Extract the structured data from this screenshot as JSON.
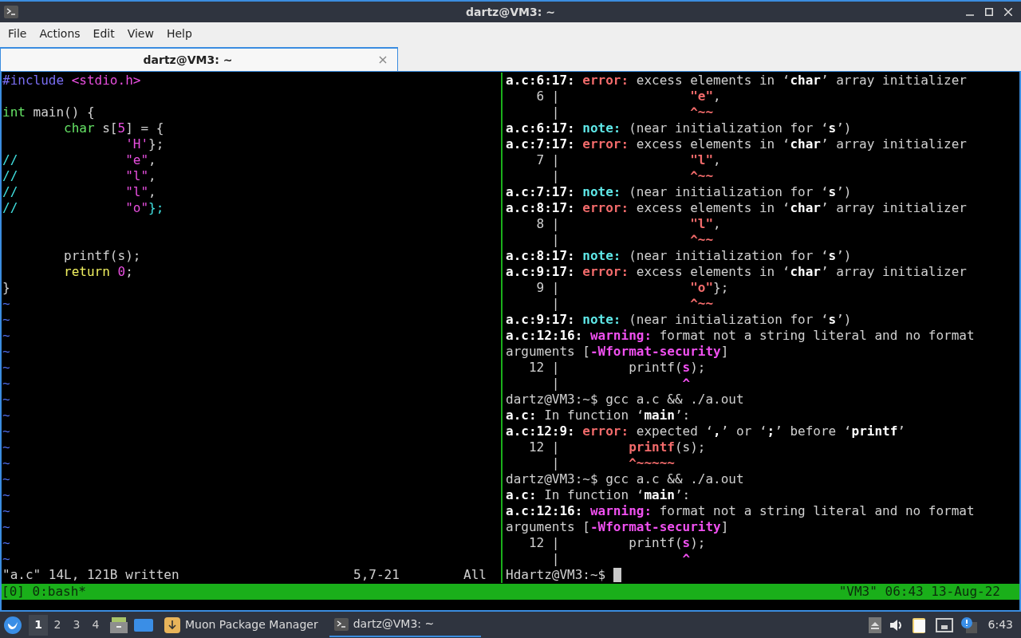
{
  "window": {
    "title": "dartz@VM3: ~"
  },
  "menu": [
    "File",
    "Actions",
    "Edit",
    "View",
    "Help"
  ],
  "tabs": [
    {
      "label": "dartz@VM3: ~",
      "selected": true,
      "close": "×"
    }
  ],
  "editor": {
    "lines": [
      {
        "kind": "text",
        "segments": [
          {
            "kind": "preproc",
            "text": "#include "
          },
          {
            "kind": "string",
            "text": "<stdio.h>"
          }
        ]
      },
      {
        "kind": "blank"
      },
      {
        "kind": "text",
        "segments": [
          {
            "kind": "type",
            "text": "int"
          },
          {
            "kind": "gray",
            "text": " main() {"
          }
        ]
      },
      {
        "kind": "text",
        "segments": [
          {
            "kind": "type",
            "text": "        char"
          },
          {
            "kind": "gray",
            "text": " s["
          },
          {
            "kind": "string",
            "text": "5"
          },
          {
            "kind": "gray",
            "text": "] = {"
          }
        ]
      },
      {
        "kind": "text",
        "segments": [
          {
            "kind": "string",
            "text": "                'H'"
          },
          {
            "kind": "gray",
            "text": "};"
          }
        ]
      },
      {
        "kind": "text",
        "segments": [
          {
            "kind": "comment",
            "text": "//              "
          },
          {
            "kind": "string",
            "text": "\"e\""
          },
          {
            "kind": "gray",
            "text": ","
          }
        ]
      },
      {
        "kind": "text",
        "segments": [
          {
            "kind": "comment",
            "text": "//              "
          },
          {
            "kind": "string",
            "text": "\"l\""
          },
          {
            "kind": "gray",
            "text": ","
          }
        ]
      },
      {
        "kind": "text",
        "segments": [
          {
            "kind": "comment",
            "text": "//              "
          },
          {
            "kind": "string",
            "text": "\"l\""
          },
          {
            "kind": "gray",
            "text": ","
          }
        ]
      },
      {
        "kind": "text",
        "segments": [
          {
            "kind": "comment",
            "text": "//              "
          },
          {
            "kind": "string",
            "text": "\"o\""
          },
          {
            "kind": "comment",
            "text": "};"
          }
        ]
      },
      {
        "kind": "blank"
      },
      {
        "kind": "blank"
      },
      {
        "kind": "text",
        "segments": [
          {
            "kind": "gray",
            "text": "        printf(s);"
          }
        ]
      },
      {
        "kind": "text",
        "segments": [
          {
            "kind": "keyword",
            "text": "        return"
          },
          {
            "kind": "string",
            "text": " 0"
          },
          {
            "kind": "gray",
            "text": ";"
          }
        ]
      },
      {
        "kind": "text",
        "segments": [
          {
            "kind": "gray",
            "text": "}"
          }
        ]
      },
      {
        "kind": "text",
        "segments": [
          {
            "kind": "tilde",
            "text": "~"
          }
        ]
      },
      {
        "kind": "text",
        "segments": [
          {
            "kind": "tilde",
            "text": "~"
          }
        ]
      },
      {
        "kind": "text",
        "segments": [
          {
            "kind": "tilde",
            "text": "~"
          }
        ]
      },
      {
        "kind": "text",
        "segments": [
          {
            "kind": "tilde",
            "text": "~"
          }
        ]
      },
      {
        "kind": "text",
        "segments": [
          {
            "kind": "tilde",
            "text": "~"
          }
        ]
      },
      {
        "kind": "text",
        "segments": [
          {
            "kind": "tilde",
            "text": "~"
          }
        ]
      },
      {
        "kind": "text",
        "segments": [
          {
            "kind": "tilde",
            "text": "~"
          }
        ]
      },
      {
        "kind": "text",
        "segments": [
          {
            "kind": "tilde",
            "text": "~"
          }
        ]
      },
      {
        "kind": "text",
        "segments": [
          {
            "kind": "tilde",
            "text": "~"
          }
        ]
      },
      {
        "kind": "text",
        "segments": [
          {
            "kind": "tilde",
            "text": "~"
          }
        ]
      },
      {
        "kind": "text",
        "segments": [
          {
            "kind": "tilde",
            "text": "~"
          }
        ]
      },
      {
        "kind": "text",
        "segments": [
          {
            "kind": "tilde",
            "text": "~"
          }
        ]
      },
      {
        "kind": "text",
        "segments": [
          {
            "kind": "tilde",
            "text": "~"
          }
        ]
      },
      {
        "kind": "text",
        "segments": [
          {
            "kind": "tilde",
            "text": "~"
          }
        ]
      },
      {
        "kind": "text",
        "segments": [
          {
            "kind": "tilde",
            "text": "~"
          }
        ]
      },
      {
        "kind": "text",
        "segments": [
          {
            "kind": "tilde",
            "text": "~"
          }
        ]
      },
      {
        "kind": "text",
        "segments": [
          {
            "kind": "tilde",
            "text": "~"
          }
        ]
      }
    ],
    "status": {
      "message": "\"a.c\" 14L, 121B written",
      "position": "5,7-21",
      "scroll": "All"
    }
  },
  "shell": {
    "lines": [
      {
        "kind": "text",
        "segments": [
          {
            "kind": "white",
            "text": "a.c:6:17: "
          },
          {
            "kind": "red",
            "text": "error: "
          },
          {
            "kind": "gray",
            "text": "excess elements in ‘"
          },
          {
            "kind": "white",
            "text": "char"
          },
          {
            "kind": "gray",
            "text": "’ array initializer"
          }
        ]
      },
      {
        "kind": "text",
        "segments": [
          {
            "kind": "gray",
            "text": "    6 |                 "
          },
          {
            "kind": "red",
            "text": "\"e\""
          },
          {
            "kind": "gray",
            "text": ","
          }
        ]
      },
      {
        "kind": "text",
        "segments": [
          {
            "kind": "gray",
            "text": "      |                 "
          },
          {
            "kind": "red",
            "text": "^~~"
          }
        ]
      },
      {
        "kind": "text",
        "segments": [
          {
            "kind": "white",
            "text": "a.c:6:17: "
          },
          {
            "kind": "cyan",
            "text": "note: "
          },
          {
            "kind": "gray",
            "text": "(near initialization for ‘"
          },
          {
            "kind": "white",
            "text": "s"
          },
          {
            "kind": "gray",
            "text": "’)"
          }
        ]
      },
      {
        "kind": "text",
        "segments": [
          {
            "kind": "white",
            "text": "a.c:7:17: "
          },
          {
            "kind": "red",
            "text": "error: "
          },
          {
            "kind": "gray",
            "text": "excess elements in ‘"
          },
          {
            "kind": "white",
            "text": "char"
          },
          {
            "kind": "gray",
            "text": "’ array initializer"
          }
        ]
      },
      {
        "kind": "text",
        "segments": [
          {
            "kind": "gray",
            "text": "    7 |                 "
          },
          {
            "kind": "red",
            "text": "\"l\""
          },
          {
            "kind": "gray",
            "text": ","
          }
        ]
      },
      {
        "kind": "text",
        "segments": [
          {
            "kind": "gray",
            "text": "      |                 "
          },
          {
            "kind": "red",
            "text": "^~~"
          }
        ]
      },
      {
        "kind": "text",
        "segments": [
          {
            "kind": "white",
            "text": "a.c:7:17: "
          },
          {
            "kind": "cyan",
            "text": "note: "
          },
          {
            "kind": "gray",
            "text": "(near initialization for ‘"
          },
          {
            "kind": "white",
            "text": "s"
          },
          {
            "kind": "gray",
            "text": "’)"
          }
        ]
      },
      {
        "kind": "text",
        "segments": [
          {
            "kind": "white",
            "text": "a.c:8:17: "
          },
          {
            "kind": "red",
            "text": "error: "
          },
          {
            "kind": "gray",
            "text": "excess elements in ‘"
          },
          {
            "kind": "white",
            "text": "char"
          },
          {
            "kind": "gray",
            "text": "’ array initializer"
          }
        ]
      },
      {
        "kind": "text",
        "segments": [
          {
            "kind": "gray",
            "text": "    8 |                 "
          },
          {
            "kind": "red",
            "text": "\"l\""
          },
          {
            "kind": "gray",
            "text": ","
          }
        ]
      },
      {
        "kind": "text",
        "segments": [
          {
            "kind": "gray",
            "text": "      |                 "
          },
          {
            "kind": "red",
            "text": "^~~"
          }
        ]
      },
      {
        "kind": "text",
        "segments": [
          {
            "kind": "white",
            "text": "a.c:8:17: "
          },
          {
            "kind": "cyan",
            "text": "note: "
          },
          {
            "kind": "gray",
            "text": "(near initialization for ‘"
          },
          {
            "kind": "white",
            "text": "s"
          },
          {
            "kind": "gray",
            "text": "’)"
          }
        ]
      },
      {
        "kind": "text",
        "segments": [
          {
            "kind": "white",
            "text": "a.c:9:17: "
          },
          {
            "kind": "red",
            "text": "error: "
          },
          {
            "kind": "gray",
            "text": "excess elements in ‘"
          },
          {
            "kind": "white",
            "text": "char"
          },
          {
            "kind": "gray",
            "text": "’ array initializer"
          }
        ]
      },
      {
        "kind": "text",
        "segments": [
          {
            "kind": "gray",
            "text": "    9 |                 "
          },
          {
            "kind": "red",
            "text": "\"o\""
          },
          {
            "kind": "gray",
            "text": "};"
          }
        ]
      },
      {
        "kind": "text",
        "segments": [
          {
            "kind": "gray",
            "text": "      |                 "
          },
          {
            "kind": "red",
            "text": "^~~"
          }
        ]
      },
      {
        "kind": "text",
        "segments": [
          {
            "kind": "white",
            "text": "a.c:9:17: "
          },
          {
            "kind": "cyan",
            "text": "note: "
          },
          {
            "kind": "gray",
            "text": "(near initialization for ‘"
          },
          {
            "kind": "white",
            "text": "s"
          },
          {
            "kind": "gray",
            "text": "’)"
          }
        ]
      },
      {
        "kind": "text",
        "segments": [
          {
            "kind": "white",
            "text": "a.c:12:16: "
          },
          {
            "kind": "magenta",
            "text": "warning: "
          },
          {
            "kind": "gray",
            "text": "format not a string literal and no format"
          }
        ]
      },
      {
        "kind": "text",
        "segments": [
          {
            "kind": "gray",
            "text": "arguments ["
          },
          {
            "kind": "magenta",
            "text": "-Wformat-security"
          },
          {
            "kind": "gray",
            "text": "]"
          }
        ]
      },
      {
        "kind": "text",
        "segments": [
          {
            "kind": "gray",
            "text": "   12 |         printf("
          },
          {
            "kind": "magenta",
            "text": "s"
          },
          {
            "kind": "gray",
            "text": ");"
          }
        ]
      },
      {
        "kind": "text",
        "segments": [
          {
            "kind": "gray",
            "text": "      |                "
          },
          {
            "kind": "magenta",
            "text": "^"
          }
        ]
      },
      {
        "kind": "text",
        "segments": [
          {
            "kind": "gray",
            "text": "dartz@VM3:~$ gcc a.c && ./a.out"
          }
        ]
      },
      {
        "kind": "text",
        "segments": [
          {
            "kind": "white",
            "text": "a.c:"
          },
          {
            "kind": "gray",
            "text": " In function ‘"
          },
          {
            "kind": "white",
            "text": "main"
          },
          {
            "kind": "gray",
            "text": "’:"
          }
        ]
      },
      {
        "kind": "text",
        "segments": [
          {
            "kind": "white",
            "text": "a.c:12:9: "
          },
          {
            "kind": "red",
            "text": "error: "
          },
          {
            "kind": "gray",
            "text": "expected ‘"
          },
          {
            "kind": "white",
            "text": ","
          },
          {
            "kind": "gray",
            "text": "’ or ‘"
          },
          {
            "kind": "white",
            "text": ";"
          },
          {
            "kind": "gray",
            "text": "’ before ‘"
          },
          {
            "kind": "white",
            "text": "printf"
          },
          {
            "kind": "gray",
            "text": "’"
          }
        ]
      },
      {
        "kind": "text",
        "segments": [
          {
            "kind": "gray",
            "text": "   12 |         "
          },
          {
            "kind": "red",
            "text": "printf"
          },
          {
            "kind": "gray",
            "text": "(s);"
          }
        ]
      },
      {
        "kind": "text",
        "segments": [
          {
            "kind": "gray",
            "text": "      |         "
          },
          {
            "kind": "red",
            "text": "^~~~~~"
          }
        ]
      },
      {
        "kind": "text",
        "segments": [
          {
            "kind": "gray",
            "text": "dartz@VM3:~$ gcc a.c && ./a.out"
          }
        ]
      },
      {
        "kind": "text",
        "segments": [
          {
            "kind": "white",
            "text": "a.c:"
          },
          {
            "kind": "gray",
            "text": " In function ‘"
          },
          {
            "kind": "white",
            "text": "main"
          },
          {
            "kind": "gray",
            "text": "’:"
          }
        ]
      },
      {
        "kind": "text",
        "segments": [
          {
            "kind": "white",
            "text": "a.c:12:16: "
          },
          {
            "kind": "magenta",
            "text": "warning: "
          },
          {
            "kind": "gray",
            "text": "format not a string literal and no format"
          }
        ]
      },
      {
        "kind": "text",
        "segments": [
          {
            "kind": "gray",
            "text": "arguments ["
          },
          {
            "kind": "magenta",
            "text": "-Wformat-security"
          },
          {
            "kind": "gray",
            "text": "]"
          }
        ]
      },
      {
        "kind": "text",
        "segments": [
          {
            "kind": "gray",
            "text": "   12 |         printf("
          },
          {
            "kind": "magenta",
            "text": "s"
          },
          {
            "kind": "gray",
            "text": ");"
          }
        ]
      },
      {
        "kind": "text",
        "segments": [
          {
            "kind": "gray",
            "text": "      |                "
          },
          {
            "kind": "magenta",
            "text": "^"
          }
        ]
      },
      {
        "kind": "prompt",
        "segments": [
          {
            "kind": "gray",
            "text": "Hdartz@VM3:~$ "
          }
        ]
      }
    ]
  },
  "tmux": {
    "left": "[0] 0:bash*",
    "right": "\"VM3\" 06:43 13-Aug-22"
  },
  "taskbar": {
    "workspaces": [
      {
        "label": "1",
        "selected": true
      },
      {
        "label": "2",
        "selected": false
      },
      {
        "label": "3",
        "selected": false
      },
      {
        "label": "4",
        "selected": false
      }
    ],
    "tasks": [
      {
        "kind": "package",
        "label": "Muon Package Manager",
        "selected": false
      },
      {
        "kind": "terminal",
        "label": "dartz@VM3: ~",
        "selected": true
      }
    ],
    "clock": "6:43"
  }
}
